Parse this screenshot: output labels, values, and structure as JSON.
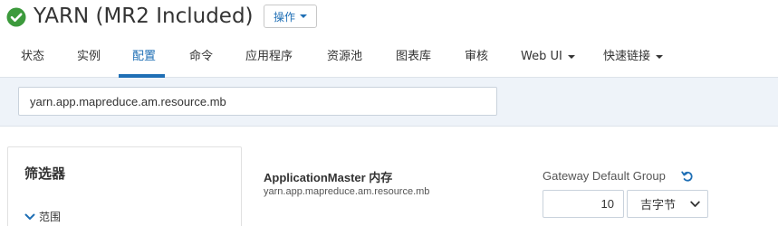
{
  "header": {
    "title": "YARN (MR2 Included)",
    "status_icon": "check-circle-icon",
    "status_color": "#3c9a3c",
    "actions_label": "操作"
  },
  "tabs": [
    {
      "label": "状态",
      "active": false
    },
    {
      "label": "实例",
      "active": false
    },
    {
      "label": "配置",
      "active": true
    },
    {
      "label": "命令",
      "active": false
    },
    {
      "label": "应用程序",
      "active": false
    },
    {
      "label": "资源池",
      "active": false
    },
    {
      "label": "图表库",
      "active": false
    },
    {
      "label": "审核",
      "active": false
    },
    {
      "label": "Web UI",
      "active": false,
      "dropdown": true
    },
    {
      "label": "快速链接",
      "active": false,
      "dropdown": true
    }
  ],
  "search": {
    "value": "yarn.app.mapreduce.am.resource.mb"
  },
  "filter": {
    "title": "筛选器",
    "scope_label": "范围"
  },
  "property": {
    "display_name": "ApplicationMaster 内存",
    "key": "yarn.app.mapreduce.am.resource.mb",
    "group_label": "Gateway Default Group",
    "value": "10",
    "unit": "吉字节"
  },
  "colors": {
    "accent": "#1f6fb5",
    "band": "#eef3f9"
  }
}
